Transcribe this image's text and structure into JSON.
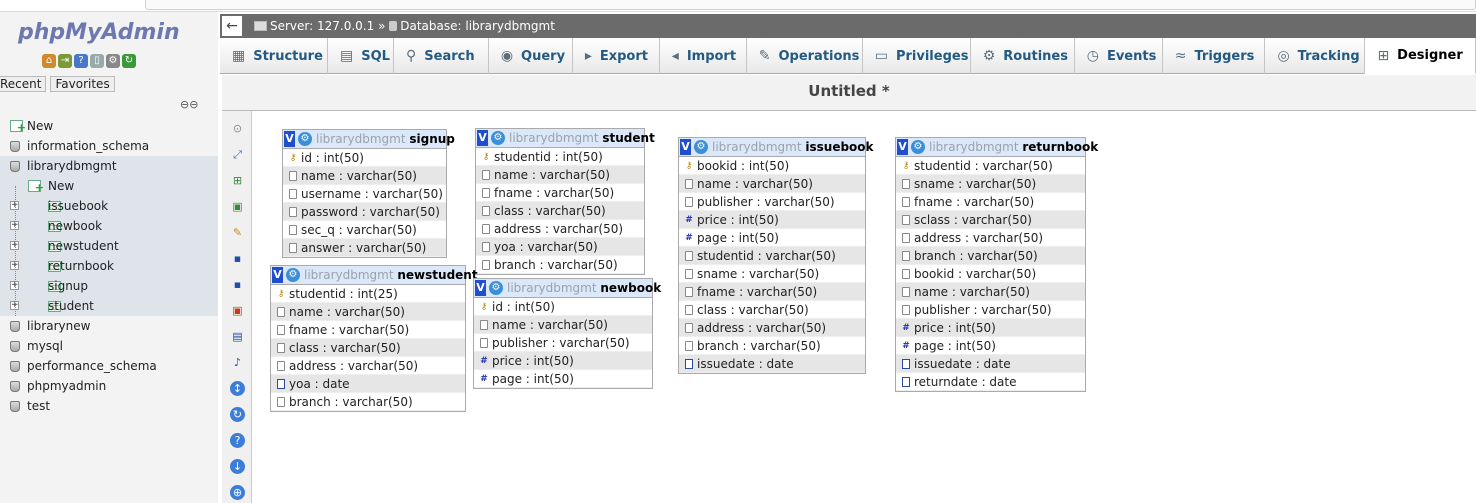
{
  "app": {
    "logo_a": "php",
    "logo_b": "MyAdmin"
  },
  "nav": {
    "tabs": [
      "Recent",
      "Favorites"
    ],
    "tree": [
      {
        "label": "New",
        "kind": "new",
        "level": 0
      },
      {
        "label": "information_schema",
        "kind": "db",
        "level": 0
      },
      {
        "label": "librarydbmgmt",
        "kind": "db",
        "level": 0,
        "selected": true
      },
      {
        "label": "New",
        "kind": "new",
        "level": 1,
        "selected": true
      },
      {
        "label": "issuebook",
        "kind": "table",
        "level": 1,
        "selected": true
      },
      {
        "label": "newbook",
        "kind": "table",
        "level": 1,
        "selected": true
      },
      {
        "label": "newstudent",
        "kind": "table",
        "level": 1,
        "selected": true
      },
      {
        "label": "returnbook",
        "kind": "table",
        "level": 1,
        "selected": true
      },
      {
        "label": "signup",
        "kind": "table",
        "level": 1,
        "selected": true
      },
      {
        "label": "student",
        "kind": "table",
        "level": 1,
        "selected": true
      },
      {
        "label": "librarynew",
        "kind": "db",
        "level": 0
      },
      {
        "label": "mysql",
        "kind": "db",
        "level": 0
      },
      {
        "label": "performance_schema",
        "kind": "db",
        "level": 0
      },
      {
        "label": "phpmyadmin",
        "kind": "db",
        "level": 0
      },
      {
        "label": "test",
        "kind": "db",
        "level": 0
      }
    ]
  },
  "breadcrumb": {
    "server": "Server: 127.0.0.1",
    "sep": "»",
    "database": "Database: librarydbmgmt"
  },
  "tabs": [
    {
      "label": "Structure",
      "icon": "structure-icon",
      "glyph": "▦"
    },
    {
      "label": "SQL",
      "icon": "sql-icon",
      "glyph": "▤"
    },
    {
      "label": "Search",
      "icon": "search-icon",
      "glyph": "⚲"
    },
    {
      "label": "Query",
      "icon": "query-icon",
      "glyph": "◉"
    },
    {
      "label": "Export",
      "icon": "export-icon",
      "glyph": "▸"
    },
    {
      "label": "Import",
      "icon": "import-icon",
      "glyph": "◂"
    },
    {
      "label": "Operations",
      "icon": "wrench-icon",
      "glyph": "✎"
    },
    {
      "label": "Privileges",
      "icon": "privileges-icon",
      "glyph": "▭"
    },
    {
      "label": "Routines",
      "icon": "routines-icon",
      "glyph": "⚙"
    },
    {
      "label": "Events",
      "icon": "clock-icon",
      "glyph": "◷"
    },
    {
      "label": "Triggers",
      "icon": "triggers-icon",
      "glyph": "≈"
    },
    {
      "label": "Tracking",
      "icon": "eye-icon",
      "glyph": "◎"
    },
    {
      "label": "Designer",
      "icon": "designer-icon",
      "glyph": "⊞",
      "active": true
    }
  ],
  "canvas": {
    "title": "Untitled *"
  },
  "tables": [
    {
      "id": "signup",
      "db": "librarydbmgmt",
      "name": "signup",
      "cols": [
        [
          "key",
          "id : int(50)"
        ],
        [
          "txt",
          "name : varchar(50)"
        ],
        [
          "txt",
          "username : varchar(50)"
        ],
        [
          "txt",
          "password : varchar(50)"
        ],
        [
          "txt",
          "sec_q : varchar(50)"
        ],
        [
          "txt",
          "answer : varchar(50)"
        ]
      ]
    },
    {
      "id": "student",
      "db": "librarydbmgmt",
      "name": "student",
      "cols": [
        [
          "key",
          "studentid : int(50)"
        ],
        [
          "txt",
          "name : varchar(50)"
        ],
        [
          "txt",
          "fname : varchar(50)"
        ],
        [
          "txt",
          "class : varchar(50)"
        ],
        [
          "txt",
          "address : varchar(50)"
        ],
        [
          "txt",
          "yoa : varchar(50)"
        ],
        [
          "txt",
          "branch : varchar(50)"
        ]
      ]
    },
    {
      "id": "issuebook",
      "db": "librarydbmgmt",
      "name": "issuebook",
      "cols": [
        [
          "key",
          "bookid : int(50)"
        ],
        [
          "txt",
          "name : varchar(50)"
        ],
        [
          "txt",
          "publisher : varchar(50)"
        ],
        [
          "num",
          "price : int(50)"
        ],
        [
          "num",
          "page : int(50)"
        ],
        [
          "txt",
          "studentid : varchar(50)"
        ],
        [
          "txt",
          "sname : varchar(50)"
        ],
        [
          "txt",
          "fname : varchar(50)"
        ],
        [
          "txt",
          "class : varchar(50)"
        ],
        [
          "txt",
          "address : varchar(50)"
        ],
        [
          "txt",
          "branch : varchar(50)"
        ],
        [
          "date",
          "issuedate : date"
        ]
      ]
    },
    {
      "id": "returnbook",
      "db": "librarydbmgmt",
      "name": "returnbook",
      "cols": [
        [
          "key",
          "studentid : varchar(50)"
        ],
        [
          "txt",
          "sname : varchar(50)"
        ],
        [
          "txt",
          "fname : varchar(50)"
        ],
        [
          "txt",
          "sclass : varchar(50)"
        ],
        [
          "txt",
          "address : varchar(50)"
        ],
        [
          "txt",
          "branch : varchar(50)"
        ],
        [
          "txt",
          "bookid : varchar(50)"
        ],
        [
          "txt",
          "name : varchar(50)"
        ],
        [
          "txt",
          "publisher : varchar(50)"
        ],
        [
          "num",
          "price : int(50)"
        ],
        [
          "num",
          "page : int(50)"
        ],
        [
          "date",
          "issuedate : date"
        ],
        [
          "date",
          "returndate : date"
        ]
      ]
    },
    {
      "id": "newstudent",
      "db": "librarydbmgmt",
      "name": "newstudent",
      "cols": [
        [
          "key",
          "studentid : int(25)"
        ],
        [
          "txt",
          "name : varchar(50)"
        ],
        [
          "txt",
          "fname : varchar(50)"
        ],
        [
          "txt",
          "class : varchar(50)"
        ],
        [
          "txt",
          "address : varchar(50)"
        ],
        [
          "date",
          "yoa : date"
        ],
        [
          "txt",
          "branch : varchar(50)"
        ]
      ]
    },
    {
      "id": "newbook",
      "db": "librarydbmgmt",
      "name": "newbook",
      "cols": [
        [
          "key",
          "id : int(50)"
        ],
        [
          "txt",
          "name : varchar(50)"
        ],
        [
          "txt",
          "publisher : varchar(50)"
        ],
        [
          "num",
          "price : int(50)"
        ],
        [
          "num",
          "page : int(50)"
        ]
      ]
    }
  ]
}
